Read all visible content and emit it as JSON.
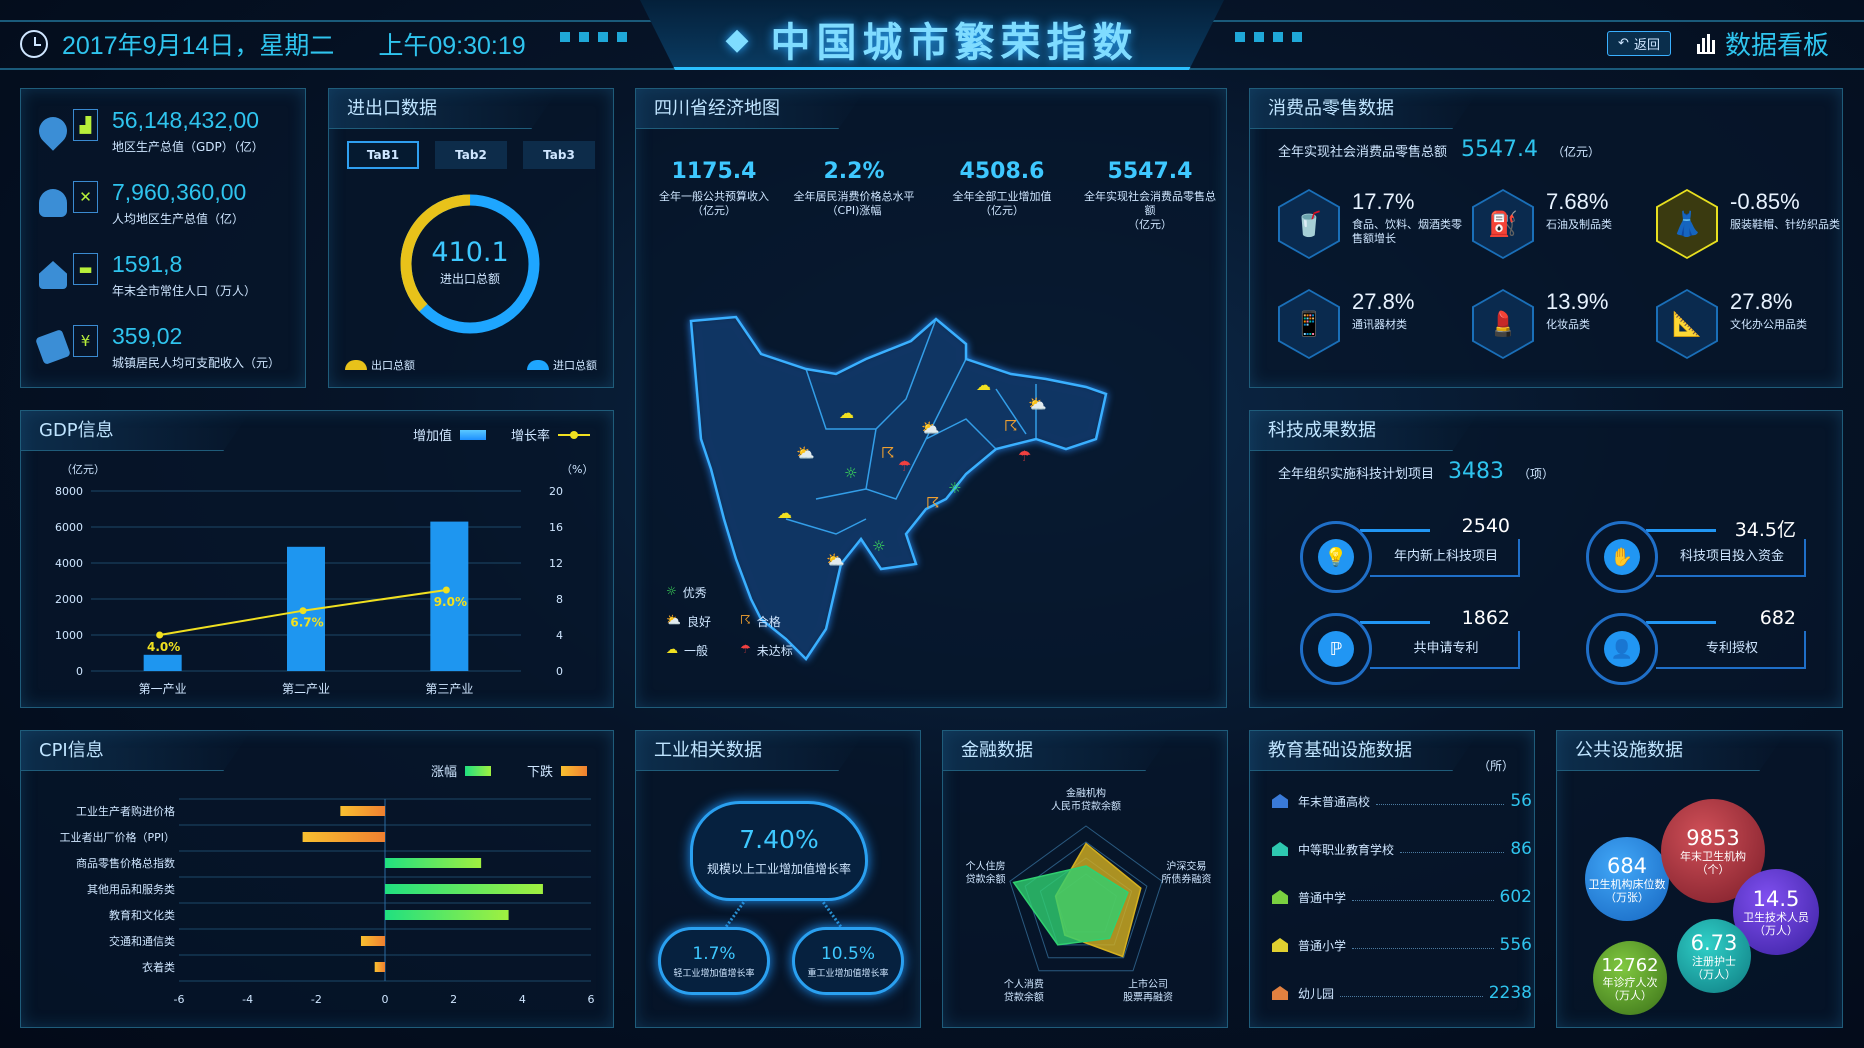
{
  "header": {
    "date": "2017年9月14日，星期二",
    "time": "上午09:30:19",
    "title": "中国城市繁荣指数",
    "back_label": "返回",
    "board_label": "数据看板"
  },
  "overview": {
    "items": [
      {
        "value": "56,148,432,00",
        "label": "地区生产总值（GDP）（亿）",
        "icon": "factory-icon"
      },
      {
        "value": "7,960,360,00",
        "label": "人均地区生产总值（亿）",
        "icon": "tools-icon"
      },
      {
        "value": "1591,8",
        "label": "年末全市常住人口（万人）",
        "icon": "bed-icon"
      },
      {
        "value": "359,02",
        "label": "城镇居民人均可支配收入（元）",
        "icon": "yuan-icon"
      }
    ]
  },
  "trade": {
    "title": "进出口数据",
    "tabs": [
      "TaB1",
      "Tab2",
      "Tab3"
    ],
    "total": "410.1",
    "total_label": "进出口总额",
    "export_label": "出口总额",
    "import_label": "进口总额",
    "export_share": 0.37,
    "colors": {
      "export": "#e8c21a",
      "import": "#1ea6ff"
    }
  },
  "map": {
    "title": "四川省经济地图",
    "stats": [
      {
        "value": "1175.4",
        "label": "全年一般公共预算收入",
        "unit": "（亿元）"
      },
      {
        "value": "2.2%",
        "label": "全年居民消费价格总水平",
        "unit": "（CPI)涨幅"
      },
      {
        "value": "4508.6",
        "label": "全年全部工业增加值",
        "unit": "（亿元）"
      },
      {
        "value": "5547.4",
        "label": "全年实现社会消费品零售总额",
        "unit": "（亿元）"
      }
    ],
    "legend": [
      {
        "label": "优秀",
        "icon": "sun-icon",
        "color": "#3ee05a"
      },
      {
        "label": "良好",
        "icon": "partly-cloudy-icon",
        "color": "#4ac6f0"
      },
      {
        "label": "合格",
        "icon": "thunder-cloud-icon",
        "color": "#f0a030"
      },
      {
        "label": "一般",
        "icon": "cloud-icon",
        "color": "#f0e020"
      },
      {
        "label": "未达标",
        "icon": "rain-cloud-icon",
        "color": "#f04040"
      }
    ]
  },
  "consumer": {
    "title": "消费品零售数据",
    "total_label": "全年实现社会消费品零售总额",
    "total_value": "5547.4",
    "total_unit": "（亿元）",
    "items": [
      {
        "value": "17.7%",
        "label": "食品、饮料、烟酒类零售额增长",
        "icon": "drink-icon"
      },
      {
        "value": "7.68%",
        "label": "石油及制品类",
        "icon": "fuel-icon"
      },
      {
        "value": "-0.85%",
        "label": "服装鞋帽、针纺织品类",
        "icon": "dress-icon"
      },
      {
        "value": "27.8%",
        "label": "通讯器材类",
        "icon": "phone-icon"
      },
      {
        "value": "13.9%",
        "label": "化妆品类",
        "icon": "cosmetics-icon"
      },
      {
        "value": "27.8%",
        "label": "文化办公用品类",
        "icon": "stationery-icon"
      }
    ]
  },
  "gdp": {
    "title": "GDP信息",
    "legend_bar": "增加值",
    "legend_line": "增长率",
    "left_unit": "（亿元）",
    "right_unit": "（%）"
  },
  "tech": {
    "title": "科技成果数据",
    "total_label": "全年组织实施科技计划项目",
    "total_value": "3483",
    "total_unit": "（项）",
    "items": [
      {
        "value": "2540",
        "label": "年内新上科技项目",
        "icon": "bulb-icon"
      },
      {
        "value": "34.5亿",
        "label": "科技项目投入资金",
        "icon": "funding-icon"
      },
      {
        "value": "1862",
        "label": "共申请专利",
        "icon": "patent-icon"
      },
      {
        "value": "682",
        "label": "专利授权",
        "icon": "license-icon"
      }
    ]
  },
  "cpi": {
    "title": "CPI信息",
    "legend_up": "涨幅",
    "legend_down": "下跌"
  },
  "industry": {
    "title": "工业相关数据",
    "main": {
      "value": "7.40%",
      "label": "规模以上工业增加值增长率"
    },
    "light": {
      "value": "1.7%",
      "label": "轻工业增加值增长率"
    },
    "heavy": {
      "value": "10.5%",
      "label": "重工业增加值增长率"
    }
  },
  "finance": {
    "title": "金融数据"
  },
  "education": {
    "title": "教育基础设施数据",
    "unit": "（所）",
    "items": [
      {
        "label": "年末普通高校",
        "value": "56",
        "color": "#3a7ad8"
      },
      {
        "label": "中等职业教育学校",
        "value": "86",
        "color": "#2ec8b0"
      },
      {
        "label": "普通中学",
        "value": "602",
        "color": "#7ad040"
      },
      {
        "label": "普通小学",
        "value": "556",
        "color": "#e0d030"
      },
      {
        "label": "幼儿园",
        "value": "2238",
        "color": "#e08040"
      }
    ]
  },
  "public": {
    "title": "公共设施数据",
    "bubbles": [
      {
        "value": "684",
        "label": "卫生机构床位数",
        "unit": "（万张）",
        "color": "#1e88e5"
      },
      {
        "value": "9853",
        "label": "年末卫生机构",
        "unit": "（个）",
        "color": "#c04048"
      },
      {
        "value": "14.5",
        "label": "卫生技术人员",
        "unit": "（万人）",
        "color": "#6a3ae0"
      },
      {
        "value": "6.73",
        "label": "注册护士",
        "unit": "（万人）",
        "color": "#20b8b0"
      },
      {
        "value": "12762",
        "label": "年诊疗人次",
        "unit": "（万人）",
        "color": "#6ab030"
      }
    ]
  },
  "chart_data": [
    {
      "type": "bar",
      "title": "GDP信息",
      "categories": [
        "第一产业",
        "第二产业",
        "第三产业"
      ],
      "series": [
        {
          "name": "增加值",
          "type": "bar",
          "axis": "left",
          "values": [
            450,
            4900,
            6300
          ]
        },
        {
          "name": "增长率",
          "type": "line",
          "axis": "right",
          "values": [
            4.0,
            6.7,
            9.0
          ],
          "labels": [
            "4.0%",
            "6.7%",
            "9.0%"
          ]
        }
      ],
      "left_ticks": [
        "0",
        "1000",
        "2000",
        "4000",
        "6000",
        "8000"
      ],
      "right_ticks": [
        "0",
        "4",
        "8",
        "12",
        "16",
        "20"
      ],
      "ylabel": "（亿元）",
      "y2label": "（%）",
      "grid": true
    },
    {
      "type": "bar",
      "orientation": "horizontal",
      "title": "CPI信息",
      "categories": [
        "工业生产者购进价格",
        "工业者出厂价格（PPI）",
        "商品零售价格总指数",
        "其他用品和服务类",
        "教育和文化类",
        "交通和通信类",
        "衣着类"
      ],
      "values": [
        -1.3,
        -2.4,
        2.8,
        4.6,
        3.6,
        -0.7,
        -0.3
      ],
      "xlim": [
        -6,
        6
      ],
      "x_ticks": [
        "-6",
        "-4",
        "-2",
        "0",
        "2",
        "4",
        "6"
      ],
      "legend": [
        "涨幅",
        "下跌"
      ]
    },
    {
      "type": "radar",
      "title": "金融数据",
      "axes": [
        "金融机构\n人民币贷款余额",
        "沪深交易\n所债券融资",
        "上市公司\n股票再融资",
        "个人消费\n贷款余额",
        "个人住房\n贷款余额"
      ],
      "series": [
        {
          "name": "series-yellow",
          "values": [
            0.78,
            0.72,
            0.78,
            0.45,
            0.4
          ],
          "color": "#d4b020"
        },
        {
          "name": "series-green",
          "values": [
            0.5,
            0.55,
            0.5,
            0.6,
            0.95
          ],
          "color": "#30d070"
        }
      ],
      "rmax": 1
    }
  ]
}
